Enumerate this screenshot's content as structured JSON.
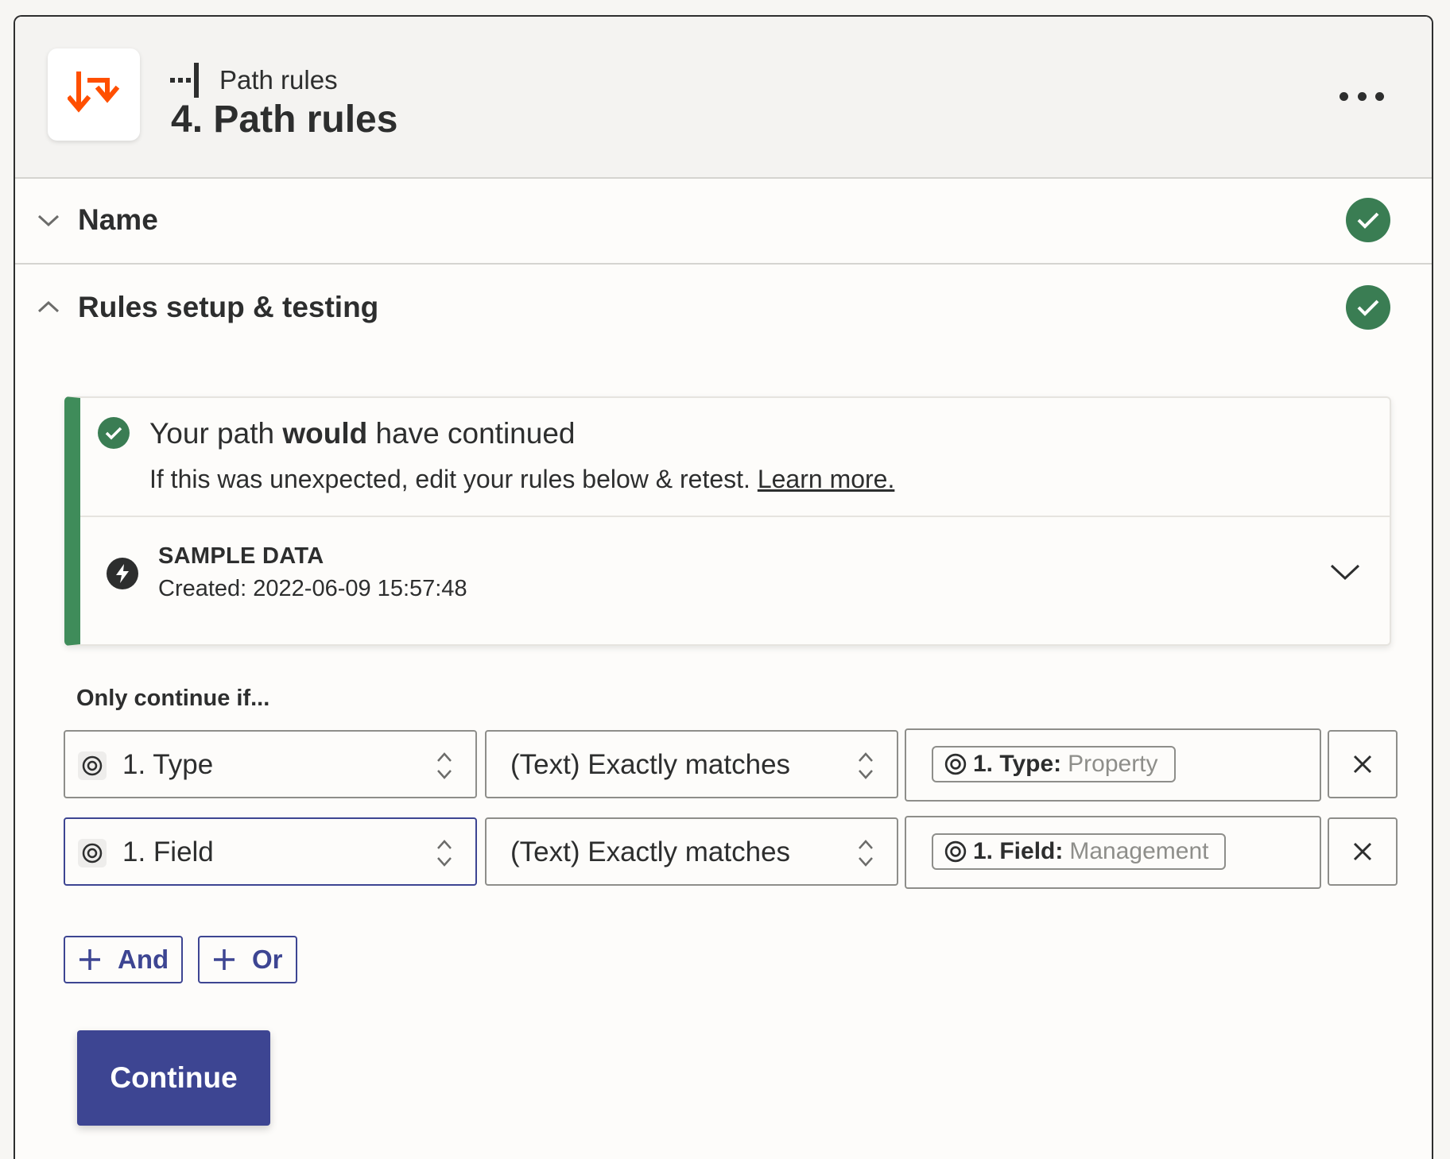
{
  "header": {
    "step_type": "Path rules",
    "title": "4. Path rules",
    "app_icon": "path-rules-icon",
    "brand_color": "#ff4f00"
  },
  "sections": {
    "name": {
      "label": "Name",
      "status": "complete"
    },
    "rules": {
      "label": "Rules setup & testing",
      "status": "complete"
    }
  },
  "result": {
    "title_prefix": "Your path ",
    "title_bold": "would",
    "title_suffix": " have continued",
    "subtitle": "If this was unexpected, edit your rules below & retest. ",
    "learn_more": "Learn more.",
    "accent_color": "#3f8c5a"
  },
  "sample": {
    "label": "SAMPLE DATA",
    "created": "Created: 2022-06-09 15:57:48"
  },
  "rules": {
    "heading": "Only continue if...",
    "rows": [
      {
        "field": "1. Type",
        "condition": "(Text) Exactly matches",
        "value_key": "1. Type:",
        "value_text": "Property"
      },
      {
        "field": "1. Field",
        "condition": "(Text) Exactly matches",
        "value_key": "1. Field:",
        "value_text": "Management"
      }
    ],
    "and_label": "And",
    "or_label": "Or"
  },
  "actions": {
    "continue_label": "Continue",
    "primary_color": "#3d4592"
  }
}
